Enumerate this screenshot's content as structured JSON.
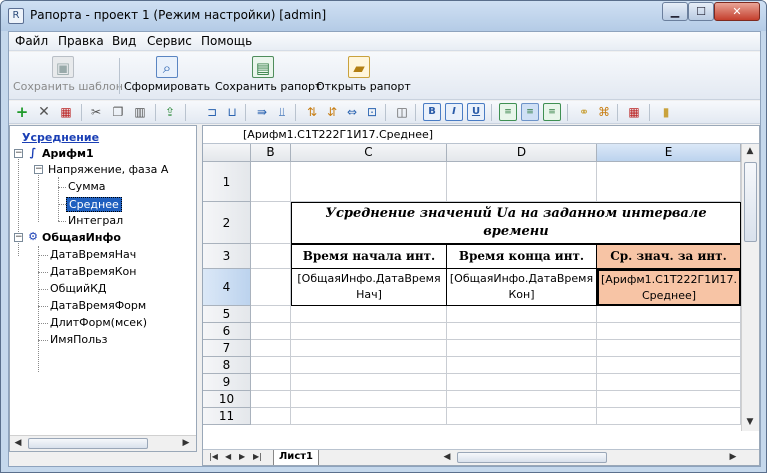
{
  "window": {
    "title": "Рапорта - проект 1 (Режим настройки) [admin]",
    "min_glyph": "▁",
    "max_glyph": "☐",
    "close_glyph": "✕",
    "app_icon_glyph": "R"
  },
  "menu": [
    "Файл",
    "Правка",
    "Вид",
    "Сервис",
    "Помощь"
  ],
  "toolbar": {
    "save_template": "Сохранить шаблон",
    "generate": "Сформировать",
    "save_report": "Сохранить рапорт",
    "open_report": "Открыть рапорт"
  },
  "format_toolbar": {
    "bold": "B",
    "italic": "I",
    "underline": "U"
  },
  "tree": {
    "root": "Усреднение",
    "node1": "Арифм1",
    "node1_child": "Напряжение, фаза А",
    "leaves1": [
      "Сумма",
      "Среднее",
      "Интеграл"
    ],
    "selected": "Среднее",
    "node2": "ОбщаяИнфо",
    "leaves2": [
      "ДатаВремяНач",
      "ДатаВремяКон",
      "ОбщийКД",
      "ДатаВремяФорм",
      "ДлитФорм(мсек)",
      "ИмяПольз"
    ]
  },
  "formula_bar": "[Арифм1.С1Т222Г1И17.Среднее]",
  "columns": [
    "B",
    "C",
    "D",
    "E"
  ],
  "rows": [
    "1",
    "2",
    "3",
    "4",
    "5",
    "6",
    "7",
    "8",
    "9",
    "10",
    "11"
  ],
  "cells": {
    "title": "Усреднение значений Ua на заданном интервале времени",
    "h1": "Время начала инт.",
    "h2": "Время конца инт.",
    "h3": "Ср. знач. за инт.",
    "v1": "[ОбщаяИнфо.ДатаВремяНач]",
    "v2": "[ОбщаяИнфо.ДатаВремяКон]",
    "v3": "[Арифм1.С1Т222Г1И17.Среднее]"
  },
  "sheet": {
    "tab": "Лист1"
  },
  "colors": {
    "selected_cell_fill": "#f7c4a5",
    "selection_blue": "#1e5fbf",
    "link_blue": "#1a3fb5"
  }
}
